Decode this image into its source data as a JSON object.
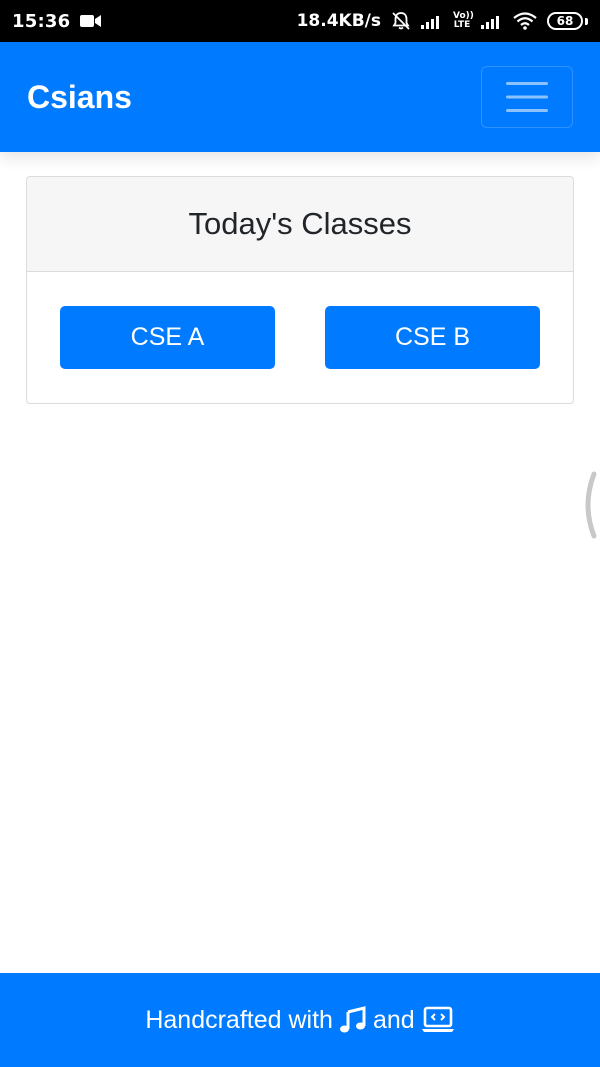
{
  "status_bar": {
    "time": "15:36",
    "network_speed": "18.4KB/s",
    "volte_top": "Vo))",
    "volte_bottom": "LTE",
    "battery_level": "68",
    "icons": [
      "video-camera-icon",
      "bell-off-icon",
      "signal-icon",
      "volte-icon",
      "signal-icon",
      "wifi-icon",
      "battery-icon"
    ]
  },
  "navbar": {
    "brand": "Csians",
    "menu_icon": "hamburger-menu-icon"
  },
  "card": {
    "title": "Today's Classes",
    "buttons": [
      {
        "label": "CSE A"
      },
      {
        "label": "CSE B"
      }
    ]
  },
  "footer": {
    "text_before": "Handcrafted with",
    "text_middle": "and",
    "icons": [
      "music-note-icon",
      "laptop-code-icon"
    ]
  },
  "colors": {
    "primary": "#007bff",
    "status_bar": "#000000",
    "card_header_bg": "#f6f6f6",
    "text_dark": "#212529"
  }
}
